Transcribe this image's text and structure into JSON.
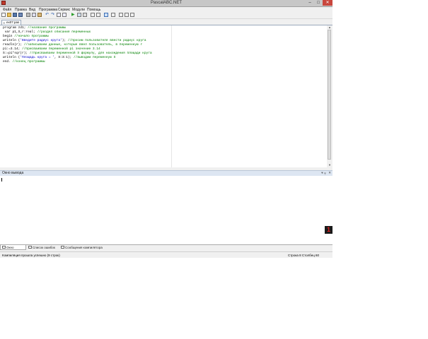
{
  "window": {
    "title": "PascalABC.NET",
    "controls": {
      "minimize": "–",
      "maximize": "□",
      "close": "✕"
    }
  },
  "menu": [
    "Файл",
    "Правка",
    "Вид",
    "Программа",
    "Сервис",
    "Модули",
    "Помощь"
  ],
  "toolbar": {
    "icons": [
      "new-file-icon",
      "open-folder-icon",
      "save-icon",
      "save-all-icon",
      "print-icon",
      "cut-icon",
      "copy-icon",
      "paste-icon",
      "undo-icon",
      "redo-icon",
      "find-icon",
      "replace-icon",
      "run-icon",
      "run-to-cursor-icon",
      "stop-icon",
      "step-over-icon",
      "step-into-icon",
      "debug-icon",
      "toggle-output-icon",
      "toggle-panel-icon",
      "form-designer-icon",
      "compile-icon",
      "settings-icon"
    ]
  },
  "editor_tab": {
    "label": "ex07.pas",
    "close": "✕"
  },
  "code_lines": [
    [
      {
        "t": "program zd1; ",
        "c": "kw"
      },
      {
        "t": "//название программы",
        "c": "cm"
      }
    ],
    [
      {
        "t": " var p1,S,r:real; ",
        "c": "kw"
      },
      {
        "t": "//раздел описания переменных",
        "c": "cm"
      }
    ],
    [
      {
        "t": "begin ",
        "c": "kw"
      },
      {
        "t": "//начало программы",
        "c": "cm"
      }
    ],
    [
      {
        "t": "writeln (",
        "c": "kw"
      },
      {
        "t": "'Введите радиус круга'",
        "c": "st"
      },
      {
        "t": "); ",
        "c": "kw"
      },
      {
        "t": "//просим пользователя ввести радиус круга",
        "c": "cm"
      }
    ],
    [
      {
        "t": "readln(r); ",
        "c": "kw"
      },
      {
        "t": "//записываем данные, которые ввел пользователь, в переменную r",
        "c": "cm"
      }
    ],
    [
      {
        "t": "pi:=3.14; ",
        "c": "kw"
      },
      {
        "t": "//присваиваем переменной pi значение 3.14",
        "c": "cm"
      }
    ],
    [
      {
        "t": "S:=pi*sqr(r); ",
        "c": "kw"
      },
      {
        "t": "//присваиваем переменной S формулу, для нахождения площади круга",
        "c": "cm"
      }
    ],
    [
      {
        "t": "writeln (",
        "c": "kw"
      },
      {
        "t": "'Площадь круга = '",
        "c": "st"
      },
      {
        "t": ", S:3:1); ",
        "c": "kw"
      },
      {
        "t": "//выводим переменную S",
        "c": "cm"
      }
    ],
    [
      {
        "t": "end. ",
        "c": "kw"
      },
      {
        "t": "//конец программы",
        "c": "cm"
      }
    ]
  ],
  "output_panel": {
    "title": "Окно вывода",
    "pin": "▾ ╤",
    "close": "✕"
  },
  "badge": {
    "value": "1"
  },
  "bottom_tabs": [
    "Окно вывода",
    "Список ошибок",
    "Сообщения компилятора"
  ],
  "status": {
    "message": "Компиляция прошла успешно (9 строк)",
    "position": "Строка  8   Столбец  60"
  },
  "colors": {
    "keyword": "#000000",
    "comment": "#008000",
    "string": "#0000c8",
    "accent": "#c0392b"
  }
}
